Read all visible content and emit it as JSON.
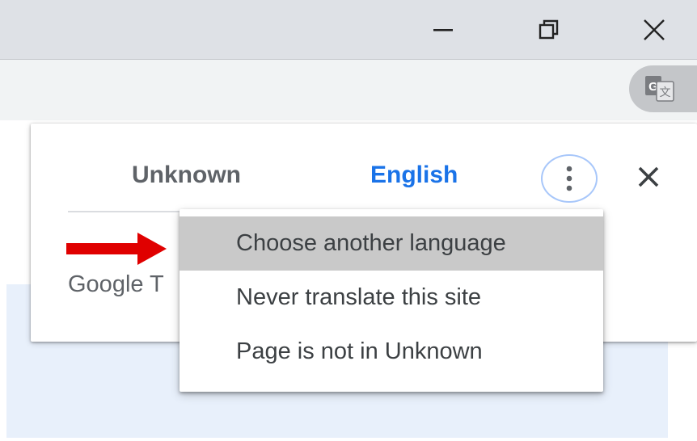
{
  "window_controls": {
    "minimize_icon": "minimize-icon",
    "restore_icon": "restore-icon",
    "close_icon": "close-icon"
  },
  "toolbar": {
    "translate_icon": "google-translate-icon"
  },
  "translate_bubble": {
    "tabs": [
      {
        "label": "Unknown",
        "selected": false
      },
      {
        "label": "English",
        "selected": true
      }
    ],
    "more_options_icon": "more-vert-icon",
    "close_icon": "close-icon",
    "footer_label": "Google T",
    "accent_color": "#1a73e8"
  },
  "options_menu": {
    "items": [
      {
        "label": "Choose another language",
        "highlighted": true
      },
      {
        "label": "Never translate this site",
        "highlighted": false
      },
      {
        "label": "Page is not in Unknown",
        "highlighted": false
      }
    ]
  },
  "annotation": {
    "arrow_icon": "red-arrow-icon",
    "arrow_color": "#e00000"
  }
}
